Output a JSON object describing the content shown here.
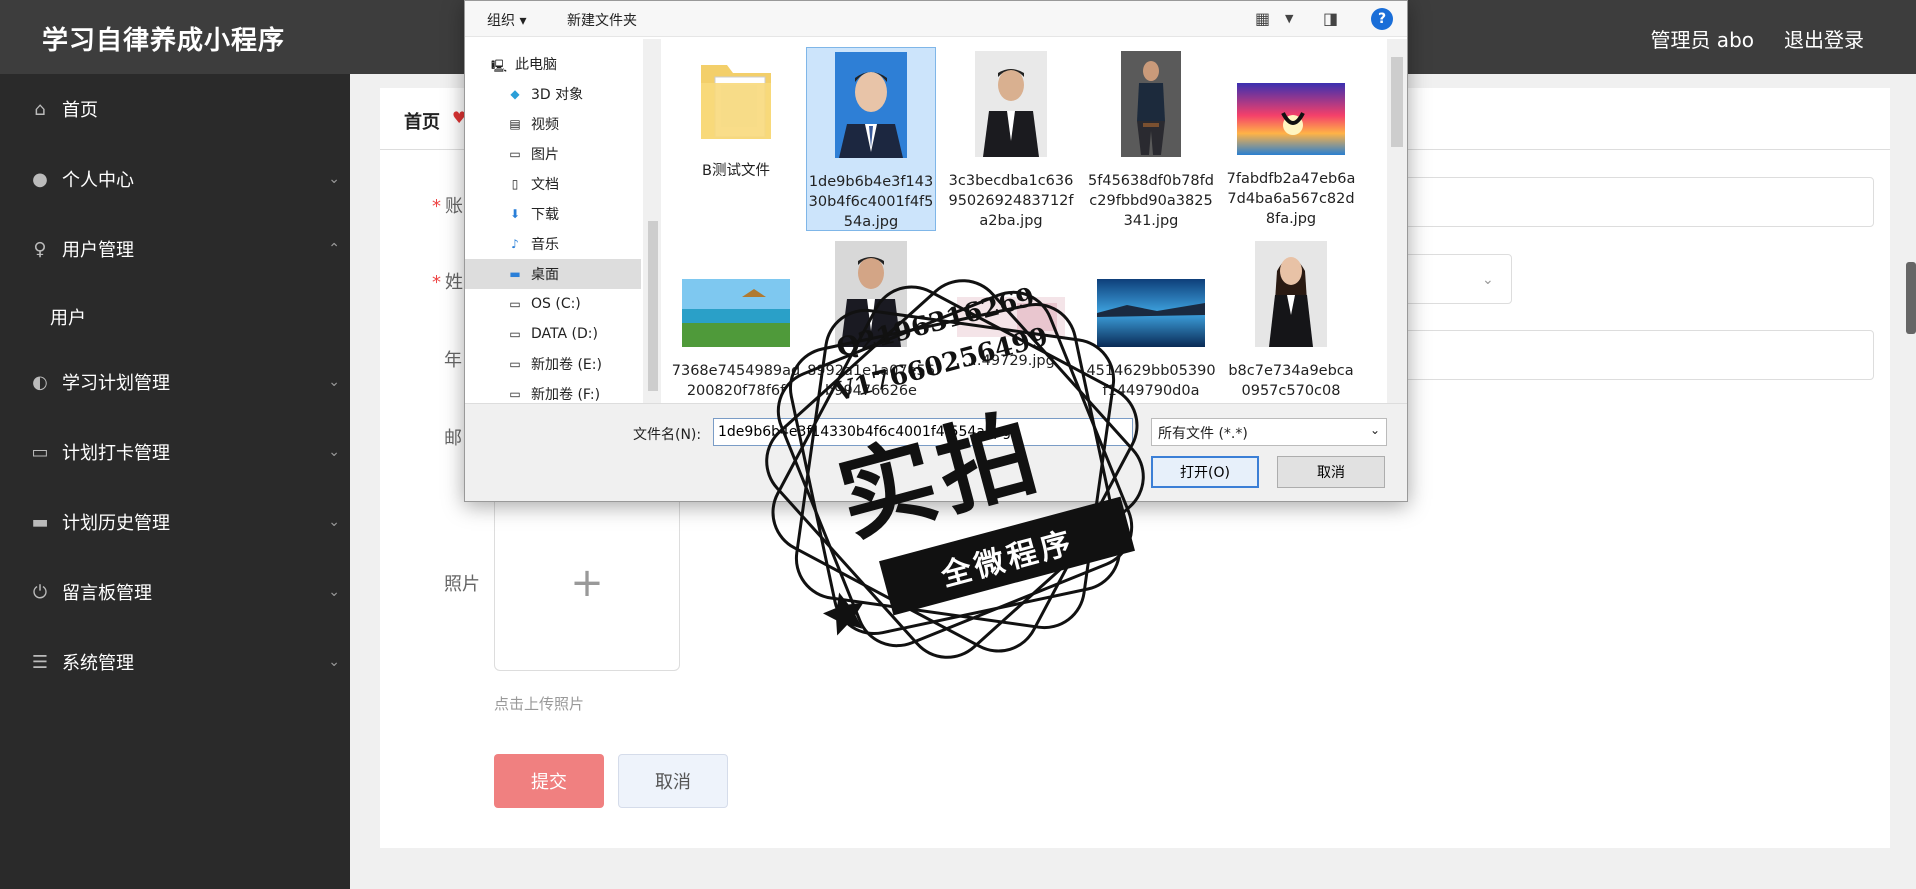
{
  "header": {
    "app_title": "学习自律养成小程序",
    "admin_label": "管理员 abo",
    "logout": "退出登录"
  },
  "sidebar": {
    "items": [
      {
        "label": "首页",
        "icon": "home-icon"
      },
      {
        "label": "个人中心",
        "icon": "user-icon"
      },
      {
        "label": "用户管理",
        "icon": "mic-icon"
      },
      {
        "label": "学习计划管理",
        "icon": "bulb-icon"
      },
      {
        "label": "计划打卡管理",
        "icon": "chat-icon"
      },
      {
        "label": "计划历史管理",
        "icon": "box-icon"
      },
      {
        "label": "留言板管理",
        "icon": "power-icon"
      },
      {
        "label": "系统管理",
        "icon": "menu-icon"
      }
    ],
    "sub_user": "用户"
  },
  "tabs": {
    "home": "首页"
  },
  "form": {
    "label_account": "账",
    "label_name": "姓",
    "label_age": "年",
    "label_email": "邮",
    "label_photo": "照片",
    "upload_hint": "点击上传照片",
    "submit": "提交",
    "cancel": "取消"
  },
  "dialog": {
    "organize": "组织 ▾",
    "new_folder": "新建文件夹",
    "nav": [
      {
        "label": "此电脑",
        "icon": "pc-icon"
      },
      {
        "label": "3D 对象",
        "icon": "cube-icon"
      },
      {
        "label": "视频",
        "icon": "video-icon"
      },
      {
        "label": "图片",
        "icon": "picture-icon"
      },
      {
        "label": "文档",
        "icon": "document-icon"
      },
      {
        "label": "下载",
        "icon": "download-icon"
      },
      {
        "label": "音乐",
        "icon": "music-icon"
      },
      {
        "label": "桌面",
        "icon": "desktop-icon"
      },
      {
        "label": "OS (C:)",
        "icon": "drive-icon"
      },
      {
        "label": "DATA (D:)",
        "icon": "drive-icon"
      },
      {
        "label": "新加卷 (E:)",
        "icon": "drive-icon"
      },
      {
        "label": "新加卷 (F:)",
        "icon": "drive-icon"
      }
    ],
    "files": [
      {
        "name": "B测试文件",
        "kind": "folder"
      },
      {
        "name": "1de9b6b4e3f14330b4f6c4001f4f554a.jpg",
        "kind": "portrait-blue"
      },
      {
        "name": "3c3becdba1c6369502692483712fa2ba.jpg",
        "kind": "portrait-dark"
      },
      {
        "name": "5f45638df0b78fdc29fbbd90a3825341.jpg",
        "kind": "portrait-seated"
      },
      {
        "name": "7fabdfb2a47eb6a7d4ba6a567c82d8fa.jpg",
        "kind": "sunset"
      },
      {
        "name": "7368e7454989ad200820f78f6f",
        "kind": "beach"
      },
      {
        "name": "8992a1e1a07e56b99476626e",
        "kind": "portrait-suit"
      },
      {
        "name": "…49729.jpg",
        "kind": "banner"
      },
      {
        "name": "4514629bb05390f1449790d0a",
        "kind": "lake"
      },
      {
        "name": "b8c7e734a9ebca0957c570c08",
        "kind": "portrait-woman"
      }
    ],
    "filename_label": "文件名(N):",
    "filename_value": "1de9b6b4e3f14330b4f6c4001f4f554a.jpg",
    "filetype": "所有文件 (*.*)",
    "open": "打开(O)",
    "cancel": "取消"
  },
  "watermark": {
    "line1": "Q2196316269",
    "line2": "V17660256499",
    "big": "实拍",
    "ribbon": "全微程序"
  }
}
